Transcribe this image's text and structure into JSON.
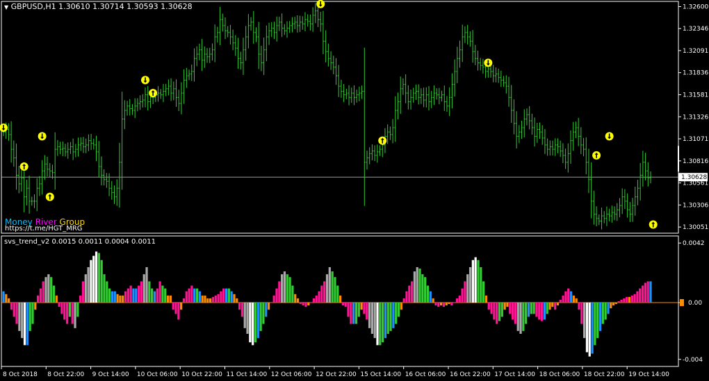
{
  "main_panel": {
    "title": "GBPUSD,H1  1.30610 1.30714 1.30593 1.30628",
    "current_price_label": "1.30628",
    "brand": {
      "part1": "Money",
      "part2": "River",
      "part3": "Group",
      "link": "https://t.me/HGT_MRG"
    },
    "y_ticks": [
      "1.32600",
      "1.32346",
      "1.32091",
      "1.31836",
      "1.31581",
      "1.31326",
      "1.31071",
      "1.30816",
      "1.30561",
      "1.30306",
      "1.30051"
    ]
  },
  "indicator_panel": {
    "title": "svs_trend_v2 0.0015 0.0011 0.0004 0.0011",
    "y_ticks": [
      "0.0042",
      "0.00",
      "-0.004"
    ]
  },
  "x_ticks": [
    "8 Oct 2018",
    "8 Oct 22:00",
    "9 Oct 14:00",
    "10 Oct 06:00",
    "10 Oct 22:00",
    "11 Oct 14:00",
    "12 Oct 06:00",
    "12 Oct 22:00",
    "15 Oct 14:00",
    "16 Oct 06:00",
    "16 Oct 22:00",
    "17 Oct 14:00",
    "18 Oct 06:00",
    "18 Oct 22:00",
    "19 Oct 14:00"
  ],
  "colors": {
    "background": "#000000",
    "axis": "#ffffff",
    "bars": "#32cd32",
    "signal": "#ffff00",
    "price_line": "#c0c0c0",
    "hist_gray": "#a9a9a9",
    "hist_white": "#ffffff",
    "hist_pink": "#ff1493",
    "hist_orange": "#ff8c00",
    "hist_blue": "#1e90ff",
    "hist_green": "#32cd32",
    "zero_line": "#ff8c00",
    "brand1": "#00bfff",
    "brand2": "#ff00ff",
    "brand3": "#ffd700"
  },
  "chart_data": [
    {
      "type": "ohlc",
      "title": "GBPUSD,H1",
      "ylim": [
        1.2998,
        1.3266
      ],
      "current_price": 1.30628,
      "closes": [
        1.3115,
        1.3118,
        1.3112,
        1.3095,
        1.3085,
        1.3065,
        1.3055,
        1.3062,
        1.304,
        1.305,
        1.3035,
        1.3035,
        1.3035,
        1.305,
        1.3055,
        1.307,
        1.3078,
        1.3072,
        1.307,
        1.3068,
        1.3095,
        1.3098,
        1.3095,
        1.3096,
        1.3092,
        1.3095,
        1.3098,
        1.3092,
        1.3095,
        1.31,
        1.3102,
        1.3098,
        1.31,
        1.3105,
        1.3102,
        1.31,
        1.3092,
        1.3075,
        1.3065,
        1.306,
        1.3058,
        1.305,
        1.3045,
        1.304,
        1.305,
        1.308,
        1.313,
        1.314,
        1.3145,
        1.3142,
        1.314,
        1.3145,
        1.3148,
        1.315,
        1.3152,
        1.3158,
        1.315,
        1.3155,
        1.3155,
        1.3158,
        1.316,
        1.3158,
        1.3162,
        1.3165,
        1.3168,
        1.316,
        1.3165,
        1.3155,
        1.3148,
        1.316,
        1.3175,
        1.318,
        1.3182,
        1.3185,
        1.32,
        1.3205,
        1.321,
        1.3198,
        1.3205,
        1.3202,
        1.3205,
        1.321,
        1.3225,
        1.323,
        1.3245,
        1.3238,
        1.3232,
        1.323,
        1.3225,
        1.3218,
        1.3212,
        1.32,
        1.3195,
        1.321,
        1.3225,
        1.3238,
        1.3242,
        1.323,
        1.3225,
        1.3205,
        1.3195,
        1.321,
        1.3225,
        1.3232,
        1.3235,
        1.323,
        1.3238,
        1.3242,
        1.3235,
        1.3232,
        1.3235,
        1.3238,
        1.324,
        1.3242,
        1.3238,
        1.3242,
        1.324,
        1.3245,
        1.3243,
        1.324,
        1.325,
        1.3255,
        1.3245,
        1.324,
        1.322,
        1.3208,
        1.32,
        1.3195,
        1.319,
        1.318,
        1.3168,
        1.3162,
        1.3158,
        1.316,
        1.3155,
        1.316,
        1.3155,
        1.3158,
        1.316,
        1.3162,
        1.308,
        1.3085,
        1.309,
        1.3093,
        1.3088,
        1.3092,
        1.3095,
        1.31,
        1.311,
        1.3115,
        1.3112,
        1.312,
        1.314,
        1.315,
        1.3165,
        1.317,
        1.316,
        1.315,
        1.3155,
        1.316,
        1.3162,
        1.3155,
        1.3158,
        1.3152,
        1.3158,
        1.315,
        1.3155,
        1.316,
        1.3158,
        1.3155,
        1.3158,
        1.315,
        1.3145,
        1.3155,
        1.317,
        1.3185,
        1.32,
        1.321,
        1.3225,
        1.323,
        1.3225,
        1.322,
        1.3208,
        1.32,
        1.3195,
        1.3192,
        1.319,
        1.3185,
        1.3188,
        1.3185,
        1.318,
        1.3182,
        1.3178,
        1.3175,
        1.3172,
        1.3168,
        1.3155,
        1.314,
        1.3125,
        1.311,
        1.3115,
        1.312,
        1.313,
        1.3135,
        1.3128,
        1.312,
        1.311,
        1.3118,
        1.3115,
        1.3108,
        1.31,
        1.3095,
        1.3098,
        1.3095,
        1.31,
        1.3098,
        1.3093,
        1.3088,
        1.308,
        1.309,
        1.3105,
        1.3115,
        1.312,
        1.311,
        1.31,
        1.3095,
        1.308,
        1.306,
        1.3035,
        1.302,
        1.3015,
        1.3012,
        1.3018,
        1.3015,
        1.302,
        1.3018,
        1.3022,
        1.302,
        1.3025,
        1.303,
        1.304,
        1.3035,
        1.3025,
        1.302,
        1.303,
        1.304,
        1.305,
        1.3065,
        1.308,
        1.307,
        1.3062,
        1.3063
      ],
      "signals": [
        {
          "index": 0,
          "price": 1.312,
          "type": "down"
        },
        {
          "index": 8,
          "price": 1.3075,
          "type": "up"
        },
        {
          "index": 15,
          "price": 1.311,
          "type": "down"
        },
        {
          "index": 18,
          "price": 1.304,
          "type": "up"
        },
        {
          "index": 55,
          "price": 1.3175,
          "type": "down"
        },
        {
          "index": 58,
          "price": 1.316,
          "type": "up"
        },
        {
          "index": 123,
          "price": 1.3263,
          "type": "down"
        },
        {
          "index": 147,
          "price": 1.3105,
          "type": "up"
        },
        {
          "index": 188,
          "price": 1.3195,
          "type": "down"
        },
        {
          "index": 230,
          "price": 1.3088,
          "type": "up"
        },
        {
          "index": 235,
          "price": 1.311,
          "type": "down"
        },
        {
          "index": 252,
          "price": 1.3008,
          "type": "up"
        }
      ]
    },
    {
      "type": "bar",
      "title": "svs_trend_v2",
      "ylim": [
        -0.0045,
        0.0047
      ],
      "colors_order": [
        "gray",
        "white",
        "pink",
        "orange",
        "blue",
        "green"
      ],
      "values": [
        0.0008,
        0.0006,
        0.0003,
        -0.0005,
        -0.001,
        -0.0015,
        -0.002,
        -0.0025,
        -0.003,
        -0.003,
        -0.002,
        -0.0015,
        -0.0005,
        0.0005,
        0.001,
        0.0015,
        0.0018,
        0.002,
        0.0018,
        0.0012,
        0.0005,
        -0.0003,
        -0.0008,
        -0.0012,
        -0.0015,
        -0.001,
        -0.0015,
        -0.0018,
        -0.001,
        0.0005,
        0.0015,
        0.002,
        0.0025,
        0.003,
        0.0033,
        0.0036,
        0.0035,
        0.003,
        0.002,
        0.0015,
        0.001,
        0.0008,
        0.0008,
        0.0006,
        0.0005,
        0.0005,
        0.0008,
        0.001,
        0.0012,
        0.001,
        0.001,
        0.0012,
        0.0015,
        0.002,
        0.0025,
        0.0015,
        0.001,
        0.0008,
        0.001,
        0.0015,
        0.0012,
        0.001,
        0.0005,
        0.0005,
        -0.0005,
        -0.0008,
        -0.0012,
        -0.0005,
        0.0003,
        0.0008,
        0.001,
        0.0012,
        0.001,
        0.001,
        0.0008,
        0.0005,
        0.0005,
        0.0003,
        0.0003,
        0.0004,
        0.0005,
        0.0006,
        0.0008,
        0.001,
        0.001,
        0.001,
        0.0008,
        0.0006,
        0.0003,
        -0.0005,
        -0.001,
        -0.0018,
        -0.0022,
        -0.0028,
        -0.003,
        -0.0028,
        -0.0025,
        -0.002,
        -0.0015,
        -0.001,
        -0.0005,
        0.0,
        0.0005,
        0.001,
        0.0015,
        0.002,
        0.0022,
        0.002,
        0.0018,
        0.0012,
        0.0006,
        0.0003,
        -0.0001,
        -0.0002,
        -0.0003,
        -0.0002,
        0.0,
        0.0003,
        0.0005,
        0.0008,
        0.0012,
        0.0015,
        0.002,
        0.0025,
        0.0022,
        0.0018,
        0.0012,
        0.0005,
        -0.0002,
        -0.0003,
        -0.001,
        -0.0015,
        -0.0015,
        -0.0015,
        -0.001,
        -0.0005,
        -0.0008,
        -0.0012,
        -0.0018,
        -0.0022,
        -0.0025,
        -0.003,
        -0.003,
        -0.0028,
        -0.0025,
        -0.0022,
        -0.002,
        -0.0018,
        -0.0015,
        -0.001,
        -0.0005,
        0.0003,
        0.0008,
        0.0012,
        0.0015,
        0.0022,
        0.0025,
        0.0024,
        0.002,
        0.0018,
        0.0012,
        0.0008,
        0.0003,
        -0.0002,
        -0.0003,
        -0.0002,
        -0.0003,
        -0.0002,
        -0.0001,
        -0.0002,
        0.0,
        0.0003,
        0.0005,
        0.001,
        0.0015,
        0.002,
        0.0025,
        0.003,
        0.0032,
        0.003,
        0.0025,
        0.0015,
        0.0005,
        -0.0005,
        -0.0008,
        -0.0012,
        -0.0015,
        -0.0013,
        -0.001,
        -0.0005,
        -0.0003,
        -0.0008,
        -0.0012,
        -0.0015,
        -0.002,
        -0.0022,
        -0.002,
        -0.0015,
        -0.001,
        -0.0008,
        -0.0008,
        -0.001,
        -0.0012,
        -0.0013,
        -0.0012,
        -0.0008,
        -0.0005,
        -0.0003,
        -0.0005,
        -0.0002,
        0.0002,
        0.0005,
        0.0008,
        0.001,
        0.0008,
        0.0005,
        0.0003,
        -0.0005,
        -0.0015,
        -0.0025,
        -0.0035,
        -0.0038,
        -0.0036,
        -0.003,
        -0.0025,
        -0.002,
        -0.0015,
        -0.0012,
        -0.0008,
        -0.0004,
        -0.0002,
        -0.0001,
        0.0001,
        0.0002,
        0.0003,
        0.0004,
        0.0004,
        0.0005,
        0.0006,
        0.0008,
        0.001,
        0.0012,
        0.0014,
        0.0015,
        0.0015
      ]
    }
  ]
}
